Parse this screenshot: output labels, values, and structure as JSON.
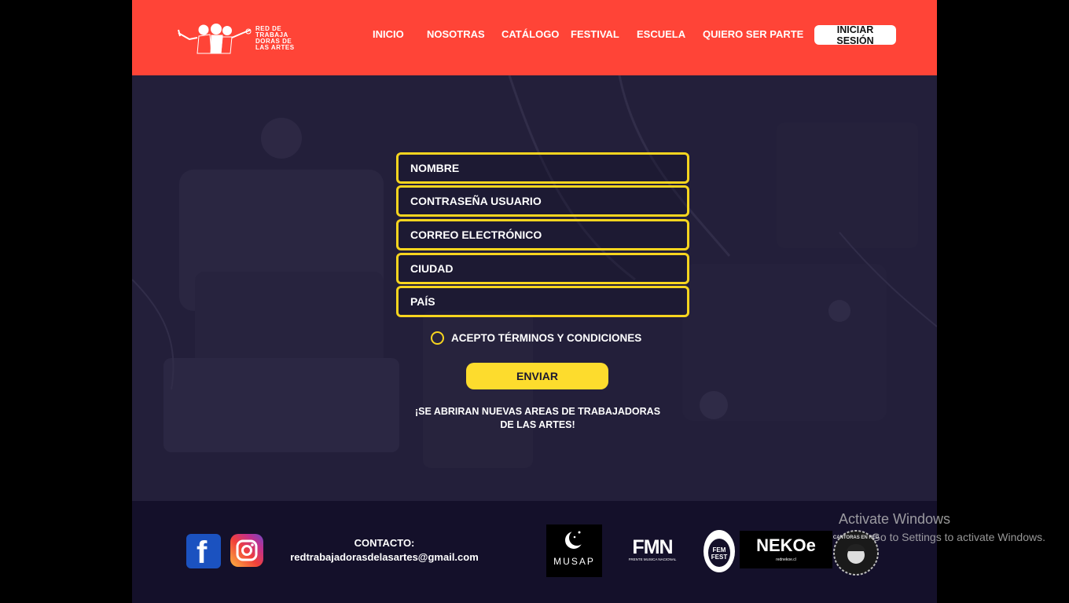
{
  "brand": {
    "logo_text": [
      "RED DE",
      "TRABAJA",
      "DORAS DE",
      "LAS ARTES"
    ]
  },
  "nav": {
    "items": [
      {
        "label": "INICIO"
      },
      {
        "label": "NOSOTRAS"
      },
      {
        "label": "CATÁLOGO"
      },
      {
        "label": "FESTIVAL"
      },
      {
        "label": "ESCUELA"
      },
      {
        "label": "QUIERO SER PARTE"
      }
    ],
    "login_label": "INICIAR SESIÓN"
  },
  "form": {
    "fields": {
      "nombre": "NOMBRE",
      "password": "CONTRASEÑA USUARIO",
      "email": "CORREO ELECTRÓNICO",
      "ciudad": "CIUDAD",
      "pais": "PAÍS"
    },
    "terms_label": "ACEPTO TÉRMINOS Y CONDICIONES",
    "submit_label": "ENVIAR",
    "notice_line1": "¡SE ABRIRAN NUEVAS AREAS DE TRABAJADORAS",
    "notice_line2": "DE LAS ARTES!"
  },
  "footer": {
    "contact_label": "CONTACTO:",
    "contact_email": "redtrabajadorasdelasartes@gmail.com",
    "social": [
      "facebook-icon",
      "instagram-icon"
    ],
    "partners": {
      "musap": "MUSAP",
      "fmn": "FMN",
      "fmn_sub": "FRENTE MUSICA NACIONAL",
      "femfest": "FEM FEST",
      "nekoe": "NEKOe",
      "nekoe_sub": "rednekoe.cl",
      "cantoras": "CANTORAS EN RED"
    }
  },
  "os_watermark": {
    "title": "Activate Windows",
    "subtitle": "Go to Settings to activate Windows."
  },
  "colors": {
    "header": "#ff4437",
    "accent_yellow": "#f7d51f",
    "background_dark": "#1b1830"
  }
}
